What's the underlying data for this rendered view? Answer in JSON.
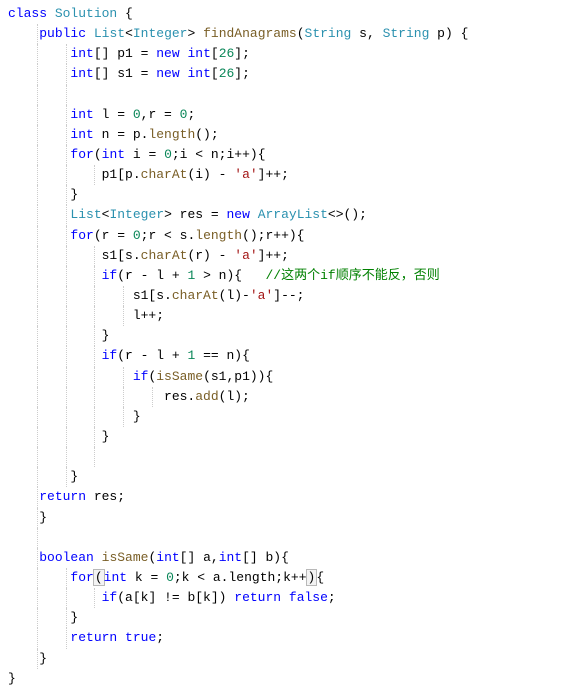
{
  "code": {
    "lines": [
      {
        "indent": 0,
        "segments": [
          {
            "t": "kw",
            "v": "class"
          },
          {
            "t": "plain",
            "v": " "
          },
          {
            "t": "cls",
            "v": "Solution"
          },
          {
            "t": "plain",
            "v": " {"
          }
        ]
      },
      {
        "indent": 1,
        "segments": [
          {
            "t": "kw",
            "v": "public"
          },
          {
            "t": "plain",
            "v": " "
          },
          {
            "t": "type",
            "v": "List"
          },
          {
            "t": "plain",
            "v": "<"
          },
          {
            "t": "type",
            "v": "Integer"
          },
          {
            "t": "plain",
            "v": "> "
          },
          {
            "t": "method",
            "v": "findAnagrams"
          },
          {
            "t": "plain",
            "v": "("
          },
          {
            "t": "type",
            "v": "String"
          },
          {
            "t": "plain",
            "v": " s, "
          },
          {
            "t": "type",
            "v": "String"
          },
          {
            "t": "plain",
            "v": " p) {"
          }
        ]
      },
      {
        "indent": 2,
        "segments": [
          {
            "t": "kw",
            "v": "int"
          },
          {
            "t": "plain",
            "v": "[] p1 = "
          },
          {
            "t": "kw",
            "v": "new"
          },
          {
            "t": "plain",
            "v": " "
          },
          {
            "t": "kw",
            "v": "int"
          },
          {
            "t": "plain",
            "v": "["
          },
          {
            "t": "num",
            "v": "26"
          },
          {
            "t": "plain",
            "v": "];"
          }
        ]
      },
      {
        "indent": 2,
        "segments": [
          {
            "t": "kw",
            "v": "int"
          },
          {
            "t": "plain",
            "v": "[] s1 = "
          },
          {
            "t": "kw",
            "v": "new"
          },
          {
            "t": "plain",
            "v": " "
          },
          {
            "t": "kw",
            "v": "int"
          },
          {
            "t": "plain",
            "v": "["
          },
          {
            "t": "num",
            "v": "26"
          },
          {
            "t": "plain",
            "v": "];"
          }
        ]
      },
      {
        "indent": 2,
        "segments": [
          {
            "t": "plain",
            "v": " "
          }
        ]
      },
      {
        "indent": 2,
        "segments": [
          {
            "t": "kw",
            "v": "int"
          },
          {
            "t": "plain",
            "v": " l = "
          },
          {
            "t": "num",
            "v": "0"
          },
          {
            "t": "plain",
            "v": ",r = "
          },
          {
            "t": "num",
            "v": "0"
          },
          {
            "t": "plain",
            "v": ";"
          }
        ]
      },
      {
        "indent": 2,
        "segments": [
          {
            "t": "kw",
            "v": "int"
          },
          {
            "t": "plain",
            "v": " n = p."
          },
          {
            "t": "method",
            "v": "length"
          },
          {
            "t": "plain",
            "v": "();"
          }
        ]
      },
      {
        "indent": 2,
        "segments": [
          {
            "t": "kw",
            "v": "for"
          },
          {
            "t": "plain",
            "v": "("
          },
          {
            "t": "kw",
            "v": "int"
          },
          {
            "t": "plain",
            "v": " i = "
          },
          {
            "t": "num",
            "v": "0"
          },
          {
            "t": "plain",
            "v": ";i < n;i++){"
          }
        ]
      },
      {
        "indent": 3,
        "segments": [
          {
            "t": "plain",
            "v": "p1[p."
          },
          {
            "t": "method",
            "v": "charAt"
          },
          {
            "t": "plain",
            "v": "(i) - "
          },
          {
            "t": "str",
            "v": "'a'"
          },
          {
            "t": "plain",
            "v": "]++;"
          }
        ]
      },
      {
        "indent": 2,
        "segments": [
          {
            "t": "plain",
            "v": "}"
          }
        ]
      },
      {
        "indent": 2,
        "segments": [
          {
            "t": "type",
            "v": "List"
          },
          {
            "t": "plain",
            "v": "<"
          },
          {
            "t": "type",
            "v": "Integer"
          },
          {
            "t": "plain",
            "v": "> res = "
          },
          {
            "t": "kw",
            "v": "new"
          },
          {
            "t": "plain",
            "v": " "
          },
          {
            "t": "type",
            "v": "ArrayList"
          },
          {
            "t": "plain",
            "v": "<>();"
          }
        ]
      },
      {
        "indent": 2,
        "segments": [
          {
            "t": "kw",
            "v": "for"
          },
          {
            "t": "plain",
            "v": "(r = "
          },
          {
            "t": "num",
            "v": "0"
          },
          {
            "t": "plain",
            "v": ";r < s."
          },
          {
            "t": "method",
            "v": "length"
          },
          {
            "t": "plain",
            "v": "();r++){"
          }
        ]
      },
      {
        "indent": 3,
        "segments": [
          {
            "t": "plain",
            "v": "s1[s."
          },
          {
            "t": "method",
            "v": "charAt"
          },
          {
            "t": "plain",
            "v": "(r) - "
          },
          {
            "t": "str",
            "v": "'a'"
          },
          {
            "t": "plain",
            "v": "]++;"
          }
        ]
      },
      {
        "indent": 3,
        "segments": [
          {
            "t": "kw",
            "v": "if"
          },
          {
            "t": "plain",
            "v": "(r - l + "
          },
          {
            "t": "num",
            "v": "1"
          },
          {
            "t": "plain",
            "v": " > n){   "
          },
          {
            "t": "cmt",
            "v": "//这两个if顺序不能反，否则"
          }
        ]
      },
      {
        "indent": 4,
        "segments": [
          {
            "t": "plain",
            "v": "s1[s."
          },
          {
            "t": "method",
            "v": "charAt"
          },
          {
            "t": "plain",
            "v": "(l)-"
          },
          {
            "t": "str",
            "v": "'a'"
          },
          {
            "t": "plain",
            "v": "]--;"
          }
        ]
      },
      {
        "indent": 4,
        "segments": [
          {
            "t": "plain",
            "v": "l++;"
          }
        ]
      },
      {
        "indent": 3,
        "segments": [
          {
            "t": "plain",
            "v": "}"
          }
        ]
      },
      {
        "indent": 3,
        "segments": [
          {
            "t": "kw",
            "v": "if"
          },
          {
            "t": "plain",
            "v": "(r - l + "
          },
          {
            "t": "num",
            "v": "1"
          },
          {
            "t": "plain",
            "v": " == n){"
          }
        ]
      },
      {
        "indent": 4,
        "segments": [
          {
            "t": "kw",
            "v": "if"
          },
          {
            "t": "plain",
            "v": "("
          },
          {
            "t": "method",
            "v": "isSame"
          },
          {
            "t": "plain",
            "v": "(s1,p1)){"
          }
        ]
      },
      {
        "indent": 5,
        "segments": [
          {
            "t": "plain",
            "v": "res."
          },
          {
            "t": "method",
            "v": "add"
          },
          {
            "t": "plain",
            "v": "(l);"
          }
        ]
      },
      {
        "indent": 4,
        "segments": [
          {
            "t": "plain",
            "v": "}"
          }
        ]
      },
      {
        "indent": 3,
        "segments": [
          {
            "t": "plain",
            "v": "}"
          }
        ]
      },
      {
        "indent": 3,
        "segments": [
          {
            "t": "plain",
            "v": " "
          }
        ]
      },
      {
        "indent": 2,
        "segments": [
          {
            "t": "plain",
            "v": "}"
          }
        ]
      },
      {
        "indent": 1,
        "segments": [
          {
            "t": "kw",
            "v": "return"
          },
          {
            "t": "plain",
            "v": " res;"
          }
        ]
      },
      {
        "indent": 1,
        "segments": [
          {
            "t": "plain",
            "v": "}"
          }
        ]
      },
      {
        "indent": 1,
        "segments": [
          {
            "t": "plain",
            "v": " "
          }
        ]
      },
      {
        "indent": 1,
        "segments": [
          {
            "t": "kw",
            "v": "boolean"
          },
          {
            "t": "plain",
            "v": " "
          },
          {
            "t": "method",
            "v": "isSame"
          },
          {
            "t": "plain",
            "v": "("
          },
          {
            "t": "kw",
            "v": "int"
          },
          {
            "t": "plain",
            "v": "[] a,"
          },
          {
            "t": "kw",
            "v": "int"
          },
          {
            "t": "plain",
            "v": "[] b){"
          }
        ]
      },
      {
        "indent": 2,
        "highlight": true,
        "segments": [
          {
            "t": "kw",
            "v": "for"
          },
          {
            "t": "hlopen",
            "v": "("
          },
          {
            "t": "kw",
            "v": "int"
          },
          {
            "t": "plain",
            "v": " k = "
          },
          {
            "t": "num",
            "v": "0"
          },
          {
            "t": "plain",
            "v": ";k < a.length;k++"
          },
          {
            "t": "hlclose",
            "v": ")"
          },
          {
            "t": "plain",
            "v": "{"
          }
        ]
      },
      {
        "indent": 3,
        "segments": [
          {
            "t": "kw",
            "v": "if"
          },
          {
            "t": "plain",
            "v": "(a[k] != b[k]) "
          },
          {
            "t": "kw",
            "v": "return"
          },
          {
            "t": "plain",
            "v": " "
          },
          {
            "t": "kw",
            "v": "false"
          },
          {
            "t": "plain",
            "v": ";"
          }
        ]
      },
      {
        "indent": 2,
        "segments": [
          {
            "t": "plain",
            "v": "}"
          }
        ]
      },
      {
        "indent": 2,
        "segments": [
          {
            "t": "kw",
            "v": "return"
          },
          {
            "t": "plain",
            "v": " "
          },
          {
            "t": "kw",
            "v": "true"
          },
          {
            "t": "plain",
            "v": ";"
          }
        ]
      },
      {
        "indent": 1,
        "segments": [
          {
            "t": "plain",
            "v": "}"
          }
        ]
      },
      {
        "indent": 0,
        "segments": [
          {
            "t": "plain",
            "v": "}"
          }
        ]
      }
    ],
    "indent_unit": "    "
  }
}
